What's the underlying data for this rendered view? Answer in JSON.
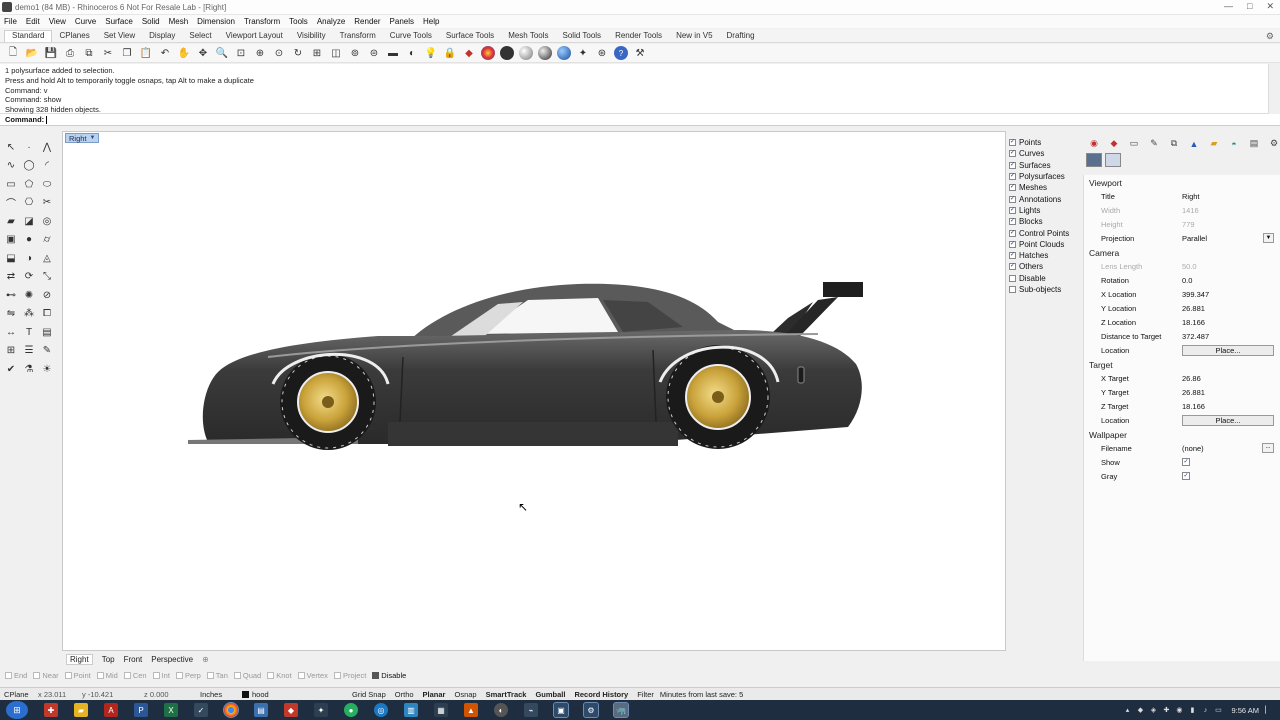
{
  "window": {
    "title": "demo1 (84 MB) - Rhinoceros 6 Not For Resale Lab - [Right]",
    "controls": [
      "—",
      "□",
      "✕"
    ]
  },
  "menu": [
    "File",
    "Edit",
    "View",
    "Curve",
    "Surface",
    "Solid",
    "Mesh",
    "Dimension",
    "Transform",
    "Tools",
    "Analyze",
    "Render",
    "Panels",
    "Help"
  ],
  "toolbar_tabs": [
    "Standard",
    "CPlanes",
    "Set View",
    "Display",
    "Select",
    "Viewport Layout",
    "Visibility",
    "Transform",
    "Curve Tools",
    "Surface Tools",
    "Mesh Tools",
    "Solid Tools",
    "Render Tools",
    "New in V5",
    "Drafting"
  ],
  "command_history": [
    "1 polysurface added to selection.",
    "Press and hold Alt to temporarily toggle osnaps, tap Alt to make a duplicate",
    "Command: v",
    "Command: show",
    "Showing 328 hidden objects."
  ],
  "command_prompt": "Command:",
  "viewport": {
    "label": "Right",
    "tabs": [
      "Right",
      "Top",
      "Front",
      "Perspective"
    ],
    "add_tab": "⊕"
  },
  "visibility": [
    "Points",
    "Curves",
    "Surfaces",
    "Polysurfaces",
    "Meshes",
    "Annotations",
    "Lights",
    "Blocks",
    "Control Points",
    "Point Clouds",
    "Hatches",
    "Others",
    "Disable",
    "Sub-objects"
  ],
  "visibility_checked": [
    true,
    true,
    true,
    true,
    true,
    true,
    true,
    true,
    true,
    true,
    true,
    true,
    false,
    false
  ],
  "properties": {
    "viewport_section": "Viewport",
    "title_label": "Title",
    "title_value": "Right",
    "width_label": "Width",
    "width_value": "1416",
    "height_label": "Height",
    "height_value": "779",
    "projection_label": "Projection",
    "projection_value": "Parallel",
    "camera_section": "Camera",
    "lens_label": "Lens Length",
    "lens_value": "50.0",
    "rotation_label": "Rotation",
    "rotation_value": "0.0",
    "xloc_label": "X Location",
    "xloc_value": "399.347",
    "yloc_label": "Y Location",
    "yloc_value": "26.881",
    "zloc_label": "Z Location",
    "zloc_value": "18.166",
    "dist_label": "Distance to Target",
    "dist_value": "372.487",
    "cam_location_label": "Location",
    "place_button": "Place...",
    "target_section": "Target",
    "xt_label": "X Target",
    "xt_value": "26.86",
    "yt_label": "Y Target",
    "yt_value": "26.881",
    "zt_label": "Z Target",
    "zt_value": "18.166",
    "tgt_location_label": "Location",
    "wallpaper_section": "Wallpaper",
    "filename_label": "Filename",
    "filename_value": "(none)",
    "show_label": "Show",
    "gray_label": "Gray"
  },
  "osnaps": [
    {
      "label": "End",
      "on": false
    },
    {
      "label": "Near",
      "on": false
    },
    {
      "label": "Point",
      "on": false
    },
    {
      "label": "Mid",
      "on": false
    },
    {
      "label": "Cen",
      "on": false
    },
    {
      "label": "Int",
      "on": false
    },
    {
      "label": "Perp",
      "on": false
    },
    {
      "label": "Tan",
      "on": false
    },
    {
      "label": "Quad",
      "on": false
    },
    {
      "label": "Knot",
      "on": false
    },
    {
      "label": "Vertex",
      "on": false
    },
    {
      "label": "Project",
      "on": false
    },
    {
      "label": "Disable",
      "on": true
    }
  ],
  "status": {
    "cplane": "CPlane",
    "x": "x 23.011",
    "y": "y -10.421",
    "z": "z 0.000",
    "units": "Inches",
    "layer": "hood",
    "grid_snap": "Grid Snap",
    "ortho": "Ortho",
    "planar": "Planar",
    "osnap": "Osnap",
    "smarttrack": "SmartTrack",
    "gumball": "Gumball",
    "record_history": "Record History",
    "filter": "Filter",
    "last_save": "Minutes from last save: 5"
  },
  "taskbar": {
    "time": "9:56 AM"
  },
  "colors": {
    "viewport_bg": "#ffffff",
    "car_body": "#3a3a3a",
    "rim_gold": "#c9a23a",
    "taskbar": "#1f2d40",
    "viewport_label_bg": "#b8d2f0"
  }
}
